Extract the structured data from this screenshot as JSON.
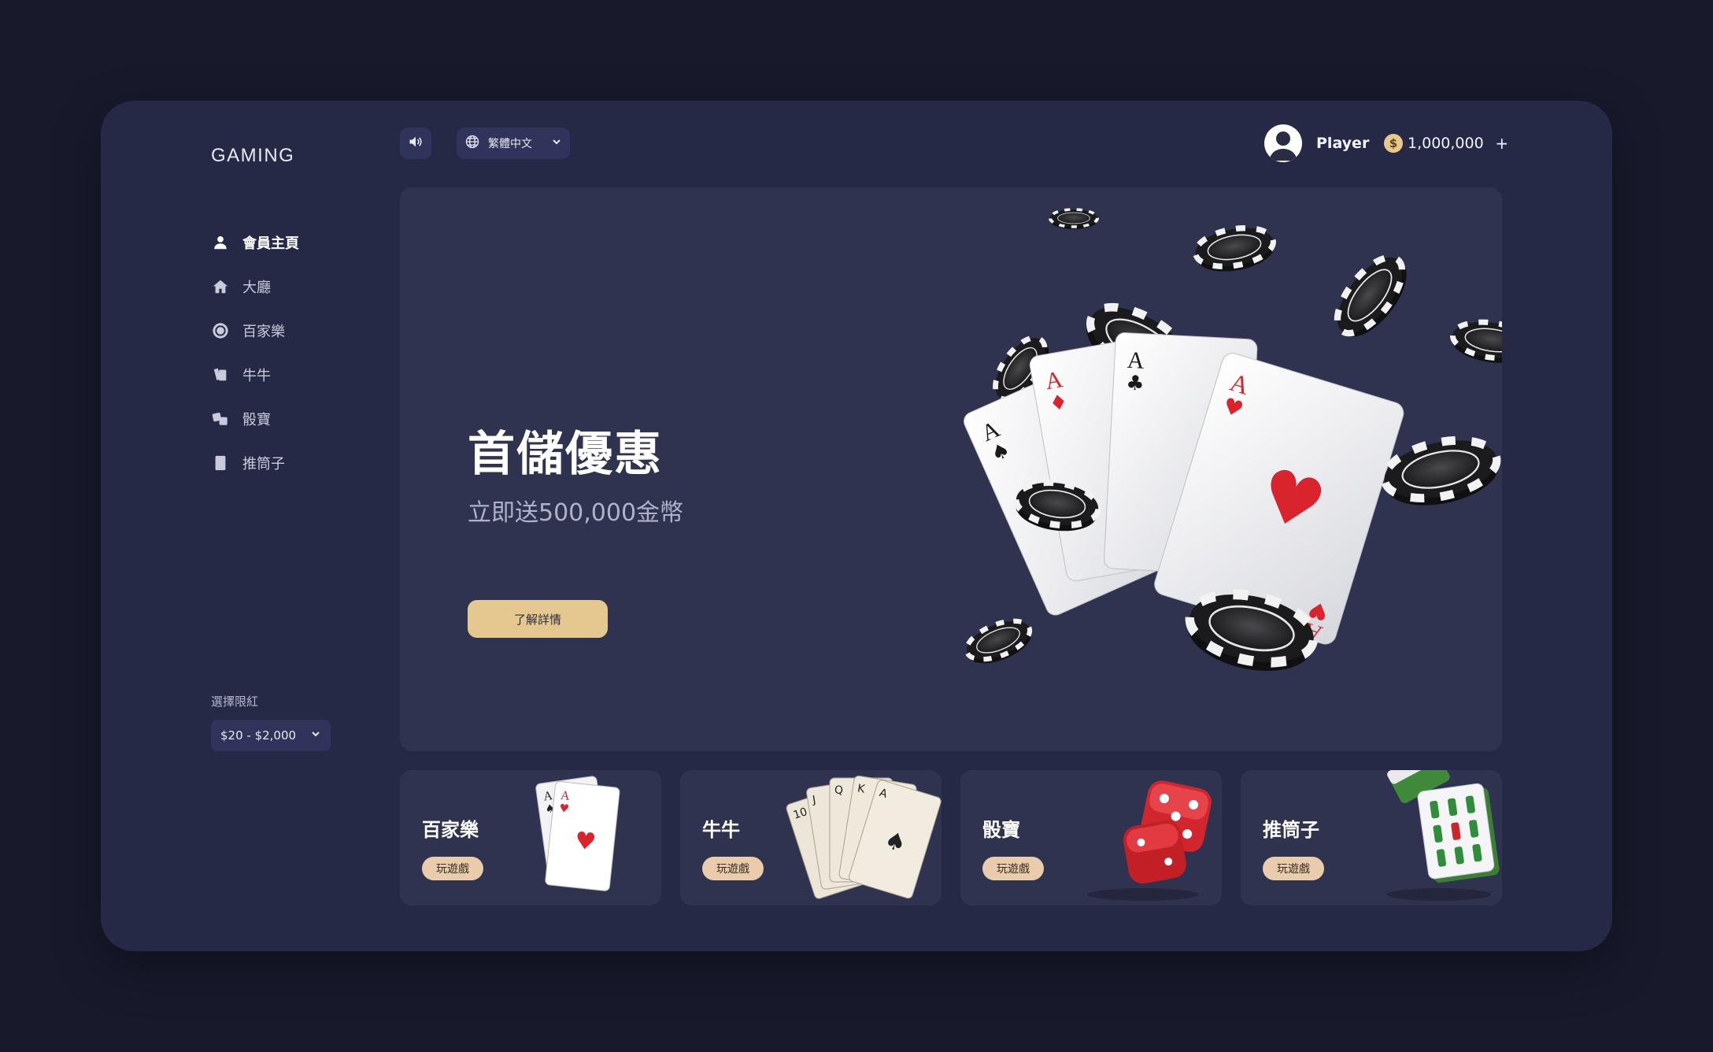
{
  "app": {
    "logo": "GAMING"
  },
  "sidebar": {
    "items": [
      {
        "label": "會員主頁",
        "icon": "person-icon",
        "active": true
      },
      {
        "label": "大廳",
        "icon": "home-icon",
        "active": false
      },
      {
        "label": "百家樂",
        "icon": "chip-icon",
        "active": false
      },
      {
        "label": "牛牛",
        "icon": "cards-icon",
        "active": false
      },
      {
        "label": "骰寶",
        "icon": "dice-icon",
        "active": false
      },
      {
        "label": "推筒子",
        "icon": "tile-icon",
        "active": false
      }
    ],
    "limit_label": "選擇限紅",
    "limit_value": "$20 - $2,000"
  },
  "header": {
    "sound_icon": "speaker-icon",
    "language": "繁體中文",
    "user_name": "Player",
    "balance": "1,000,000",
    "coin_symbol": "$",
    "add_symbol": "+"
  },
  "banner": {
    "title": "首儲優惠",
    "subtitle": "立即送500,000金幣",
    "button": "了解詳情"
  },
  "games": [
    {
      "name": "百家樂",
      "button": "玩遊戲",
      "art": "aces-cards"
    },
    {
      "name": "牛牛",
      "button": "玩遊戲",
      "art": "royal-flush-cards"
    },
    {
      "name": "骰寶",
      "button": "玩遊戲",
      "art": "red-dice"
    },
    {
      "name": "推筒子",
      "button": "玩遊戲",
      "art": "mahjong-tile"
    }
  ],
  "colors": {
    "page_bg": "#181a2c",
    "panel_bg": "#262945",
    "card_bg": "#30334f",
    "accent_gold": "#e5c88f",
    "play_pill": "#e9ccab"
  }
}
